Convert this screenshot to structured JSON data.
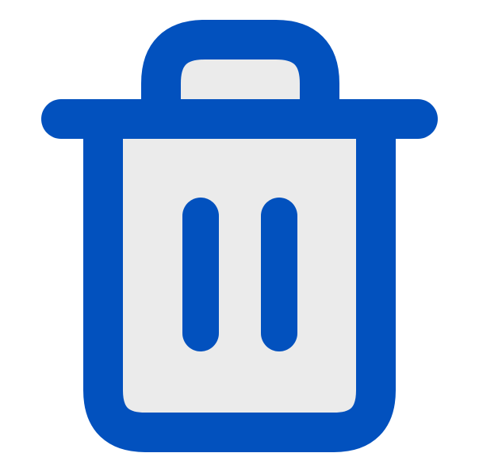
{
  "icon": {
    "name": "trash-icon",
    "stroke_color": "#0251BE",
    "fill_color": "#EBEBEB",
    "background": "#FFFFFF"
  }
}
